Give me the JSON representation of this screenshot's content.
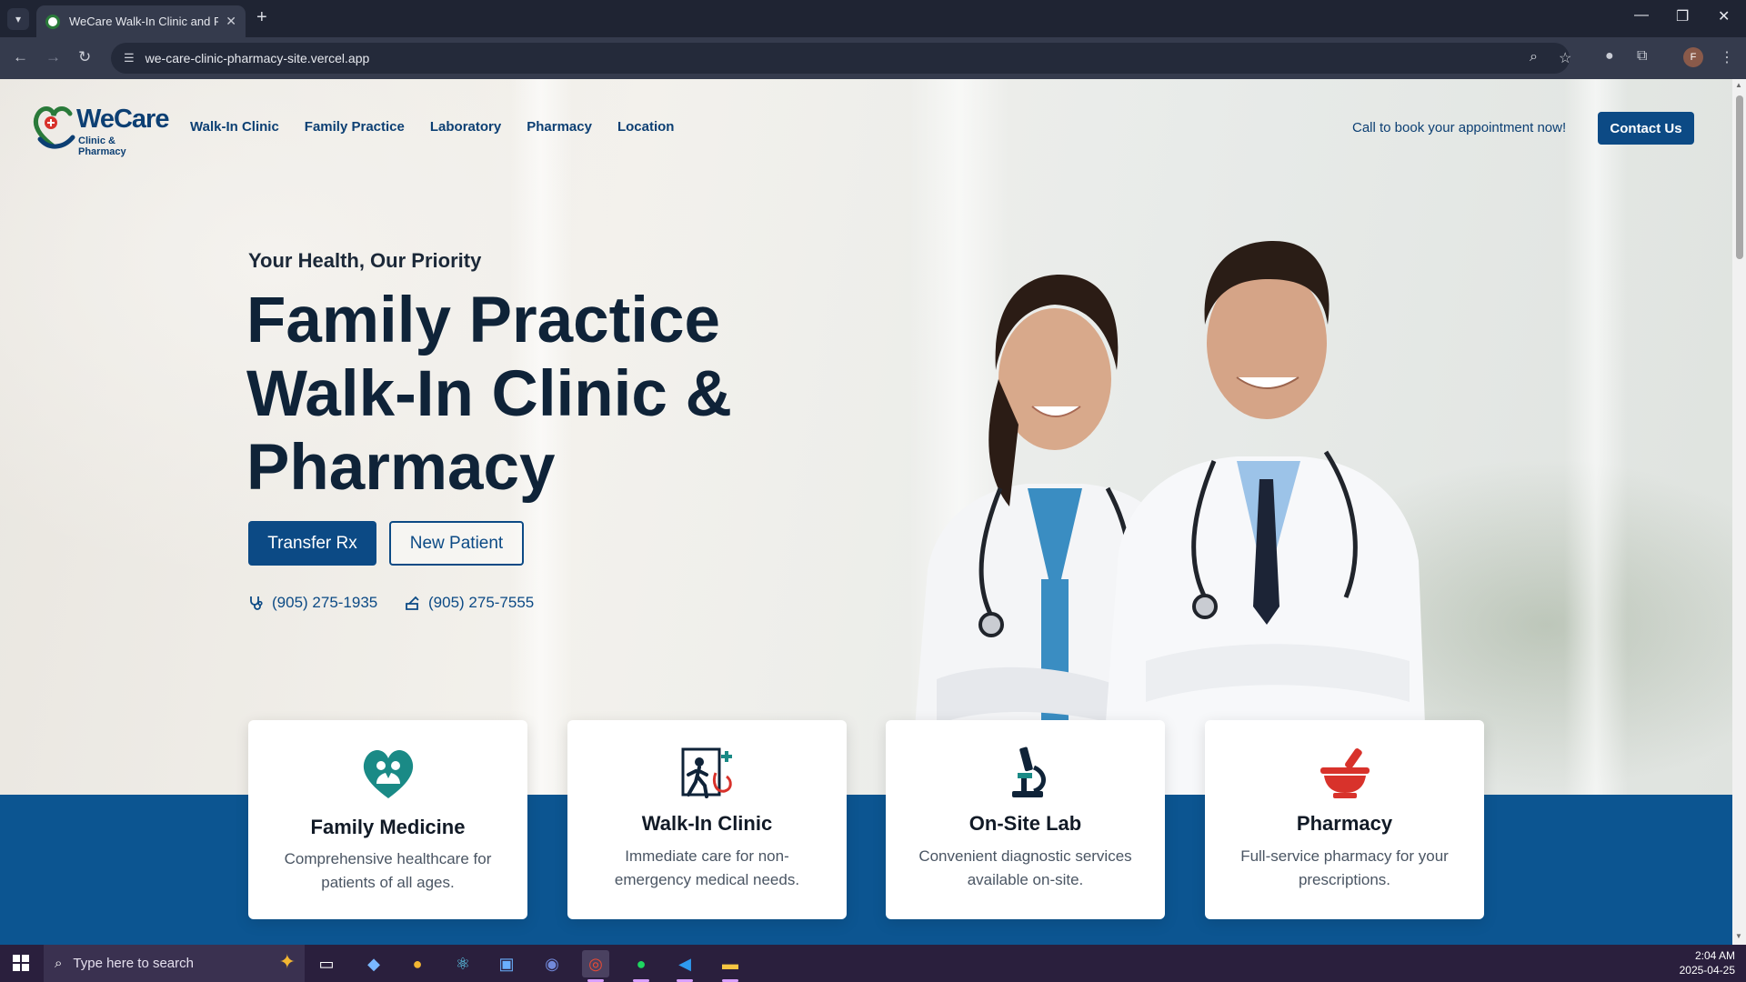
{
  "browser": {
    "tab_title": "WeCare Walk-In Clinic and Pharmacy",
    "url": "we-care-clinic-pharmacy-site.vercel.app",
    "profile_initial": "F"
  },
  "site": {
    "logo": {
      "name": "WeCare",
      "tagline": "Clinic & Pharmacy"
    },
    "nav": [
      "Walk-In Clinic",
      "Family Practice",
      "Laboratory",
      "Pharmacy",
      "Location"
    ],
    "callout": "Call to book your appointment now!",
    "contact_button": "Contact Us"
  },
  "hero": {
    "eyebrow": "Your Health, Our Priority",
    "headline_lines": [
      "Family Practice",
      "Walk-In Clinic &",
      "Pharmacy"
    ],
    "primary_button": "Transfer Rx",
    "secondary_button": "New Patient",
    "phone": "(905) 275-1935",
    "fax": "(905) 275-7555"
  },
  "services": [
    {
      "title": "Family Medicine",
      "description": "Comprehensive healthcare for patients of all ages.",
      "icon": "heart-family-icon"
    },
    {
      "title": "Walk-In Clinic",
      "description": "Immediate care for non-emergency medical needs.",
      "icon": "walk-in-icon"
    },
    {
      "title": "On-Site Lab",
      "description": "Convenient diagnostic services available on-site.",
      "icon": "microscope-icon"
    },
    {
      "title": "Pharmacy",
      "description": "Full-service pharmacy for your prescriptions.",
      "icon": "mortar-pestle-icon"
    }
  ],
  "colors": {
    "brand_navy": "#0c4a85",
    "brand_green": "#2a7a3a",
    "accent_red": "#d8322b",
    "teal": "#1a8a86"
  },
  "taskbar": {
    "search_placeholder": "Type here to search",
    "time": "2:04 AM",
    "date": "2025-04-25"
  }
}
